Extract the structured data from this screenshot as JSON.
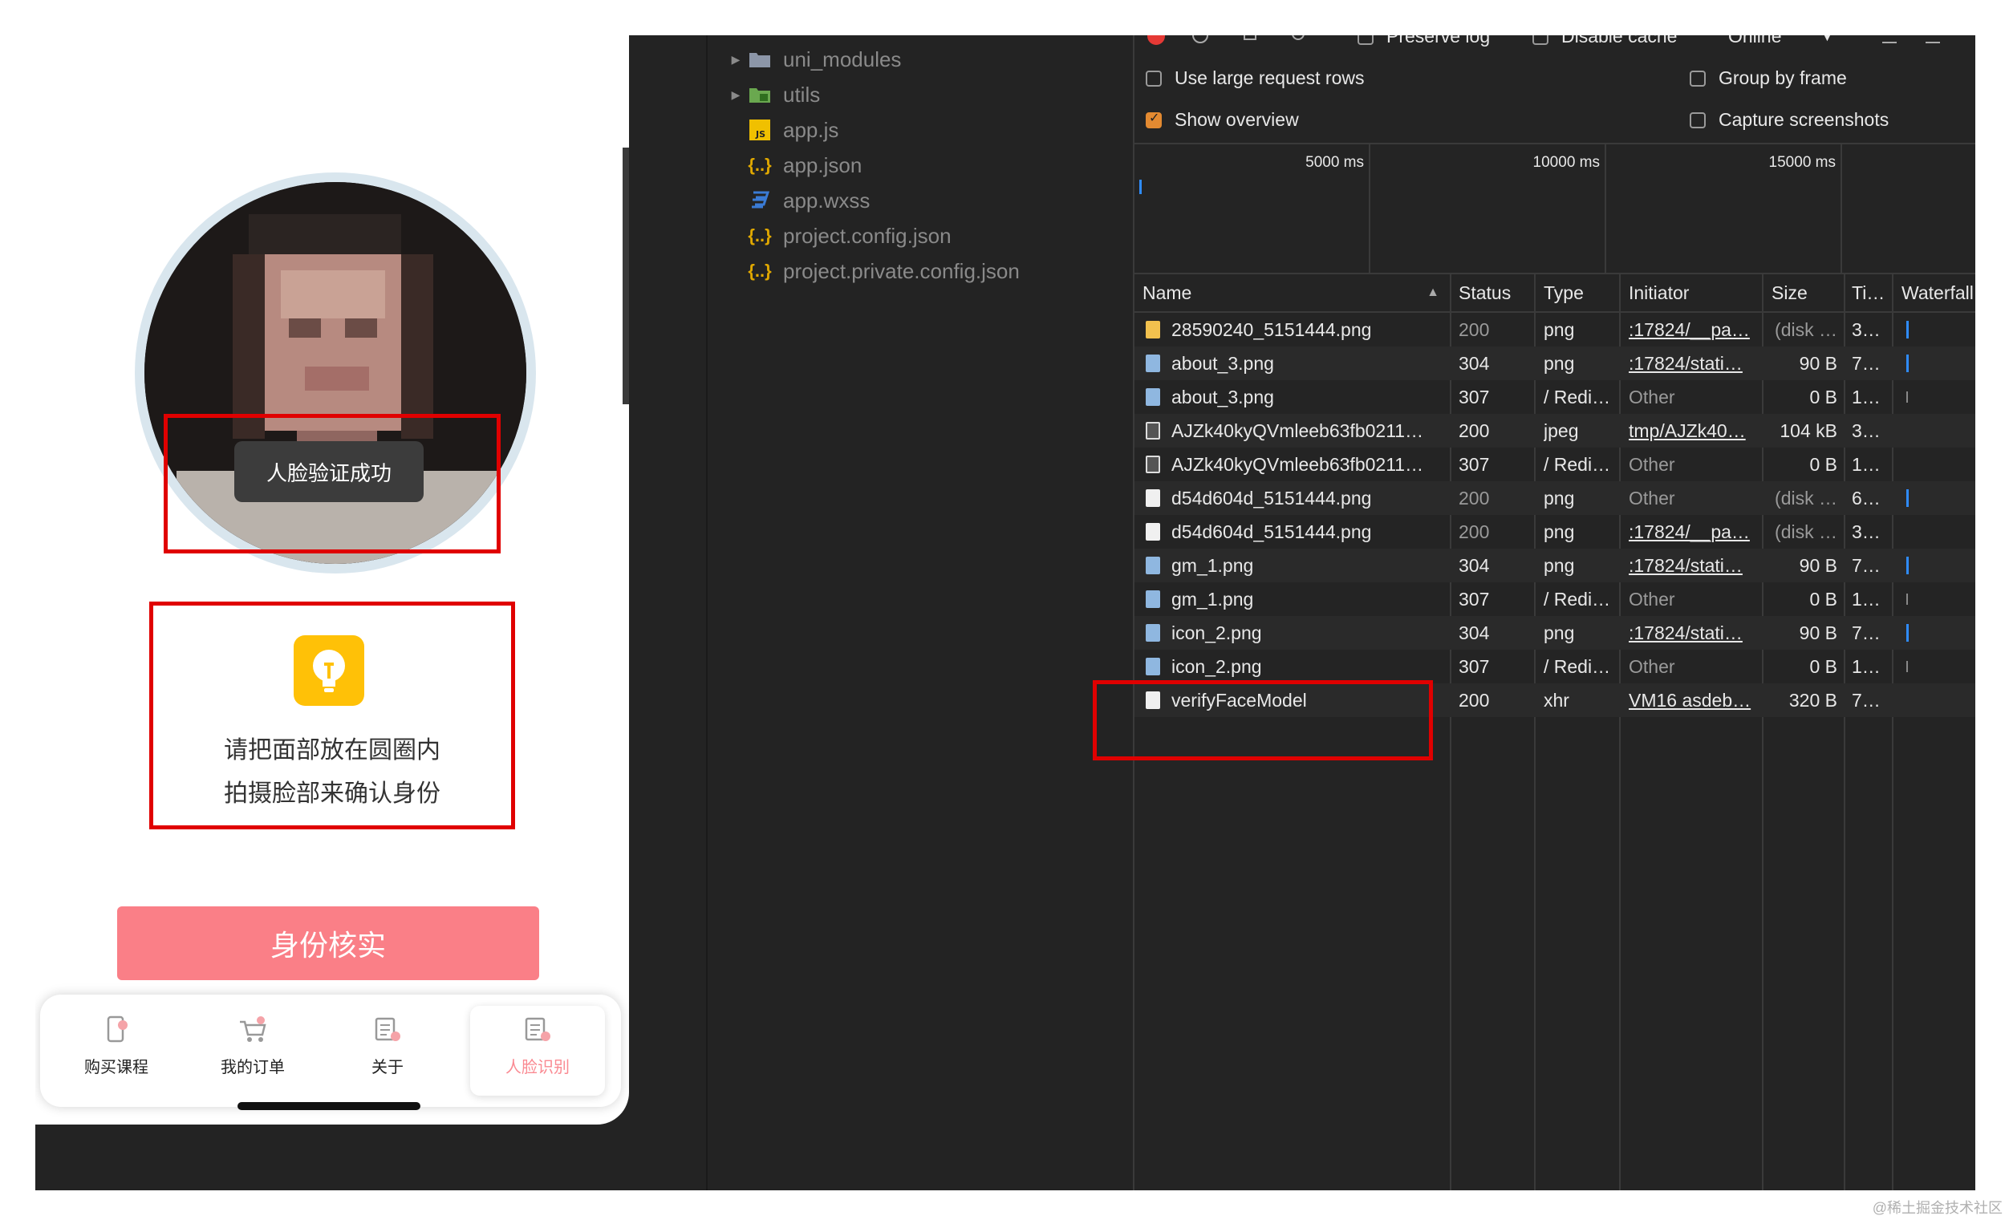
{
  "phone": {
    "toast": "人脸验证成功",
    "tip_line1": "请把面部放在圆圈内",
    "tip_line2": "拍摄脸部来确认身份",
    "verify_button": "身份核实",
    "tabs": [
      {
        "label": "购买课程",
        "icon": "course-icon"
      },
      {
        "label": "我的订单",
        "icon": "cart-icon"
      },
      {
        "label": "关于",
        "icon": "about-icon"
      },
      {
        "label": "人脸识别",
        "icon": "face-icon",
        "active": true
      }
    ]
  },
  "tree": {
    "items": [
      {
        "label": "uni_modules",
        "type": "folder"
      },
      {
        "label": "utils",
        "type": "folder-green"
      },
      {
        "label": "app.js",
        "type": "js"
      },
      {
        "label": "app.json",
        "type": "json"
      },
      {
        "label": "app.wxss",
        "type": "css"
      },
      {
        "label": "project.config.json",
        "type": "json"
      },
      {
        "label": "project.private.config.json",
        "type": "json"
      }
    ]
  },
  "network": {
    "toolbar": {
      "preserve_log": "Preserve log",
      "disable_cache": "Disable cache",
      "throttle": "Online"
    },
    "options": {
      "large_rows": "Use large request rows",
      "group_by_frame": "Group by frame",
      "show_overview": "Show overview",
      "capture_screenshots": "Capture screenshots"
    },
    "timeline": [
      "5000 ms",
      "10000 ms",
      "15000 ms"
    ],
    "columns": [
      "Name",
      "Status",
      "Type",
      "Initiator",
      "Size",
      "Ti…",
      "Waterfall"
    ],
    "rows": [
      {
        "name": "28590240_5151444.png",
        "status": "200",
        "type": "png",
        "initiator": ":17824/__pa…",
        "size": "(disk …",
        "time": "3…",
        "icon": "gold",
        "dim": true,
        "wf": "blue"
      },
      {
        "name": "about_3.png",
        "status": "304",
        "type": "png",
        "initiator": ":17824/stati…",
        "size": "90 B",
        "time": "7…",
        "icon": "pic",
        "dim": false,
        "wf": "blue"
      },
      {
        "name": "about_3.png",
        "status": "307",
        "type": "/ Redi…",
        "initiator": "Other",
        "size": "0 B",
        "time": "1…",
        "icon": "pic",
        "dim": false,
        "wf": "thin"
      },
      {
        "name": "AJZk40kyQVmleeb63fb0211…",
        "status": "200",
        "type": "jpeg",
        "initiator": "tmp/AJZk40…",
        "size": "104 kB",
        "time": "3…",
        "icon": "dark",
        "dim": false,
        "wf": ""
      },
      {
        "name": "AJZk40kyQVmleeb63fb0211…",
        "status": "307",
        "type": "/ Redi…",
        "initiator": "Other",
        "size": "0 B",
        "time": "1…",
        "icon": "dark",
        "dim": false,
        "wf": ""
      },
      {
        "name": "d54d604d_5151444.png",
        "status": "200",
        "type": "png",
        "initiator": "Other",
        "size": "(disk …",
        "time": "6…",
        "icon": "white",
        "dim": true,
        "wf": "blue"
      },
      {
        "name": "d54d604d_5151444.png",
        "status": "200",
        "type": "png",
        "initiator": ":17824/__pa…",
        "size": "(disk …",
        "time": "3…",
        "icon": "white",
        "dim": true,
        "wf": ""
      },
      {
        "name": "gm_1.png",
        "status": "304",
        "type": "png",
        "initiator": ":17824/stati…",
        "size": "90 B",
        "time": "7…",
        "icon": "pic",
        "dim": false,
        "wf": "blue"
      },
      {
        "name": "gm_1.png",
        "status": "307",
        "type": "/ Redi…",
        "initiator": "Other",
        "size": "0 B",
        "time": "1…",
        "icon": "pic",
        "dim": false,
        "wf": "thin"
      },
      {
        "name": "icon_2.png",
        "status": "304",
        "type": "png",
        "initiator": ":17824/stati…",
        "size": "90 B",
        "time": "7…",
        "icon": "pic",
        "dim": false,
        "wf": "blue"
      },
      {
        "name": "icon_2.png",
        "status": "307",
        "type": "/ Redi…",
        "initiator": "Other",
        "size": "0 B",
        "time": "1…",
        "icon": "pic",
        "dim": false,
        "wf": "thin"
      },
      {
        "name": "verifyFaceModel",
        "status": "200",
        "type": "xhr",
        "initiator": "VM16 asdeb…",
        "size": "320 B",
        "time": "7…",
        "icon": "white",
        "dim": false,
        "wf": ""
      }
    ]
  },
  "watermark": "@稀土掘金技术社区",
  "colors": {
    "accent_red": "#e00000",
    "button_pink": "#fa7f87",
    "tip_yellow": "#ffc107",
    "devtools_bg": "#242424",
    "checkbox_orange": "#e38a31"
  }
}
